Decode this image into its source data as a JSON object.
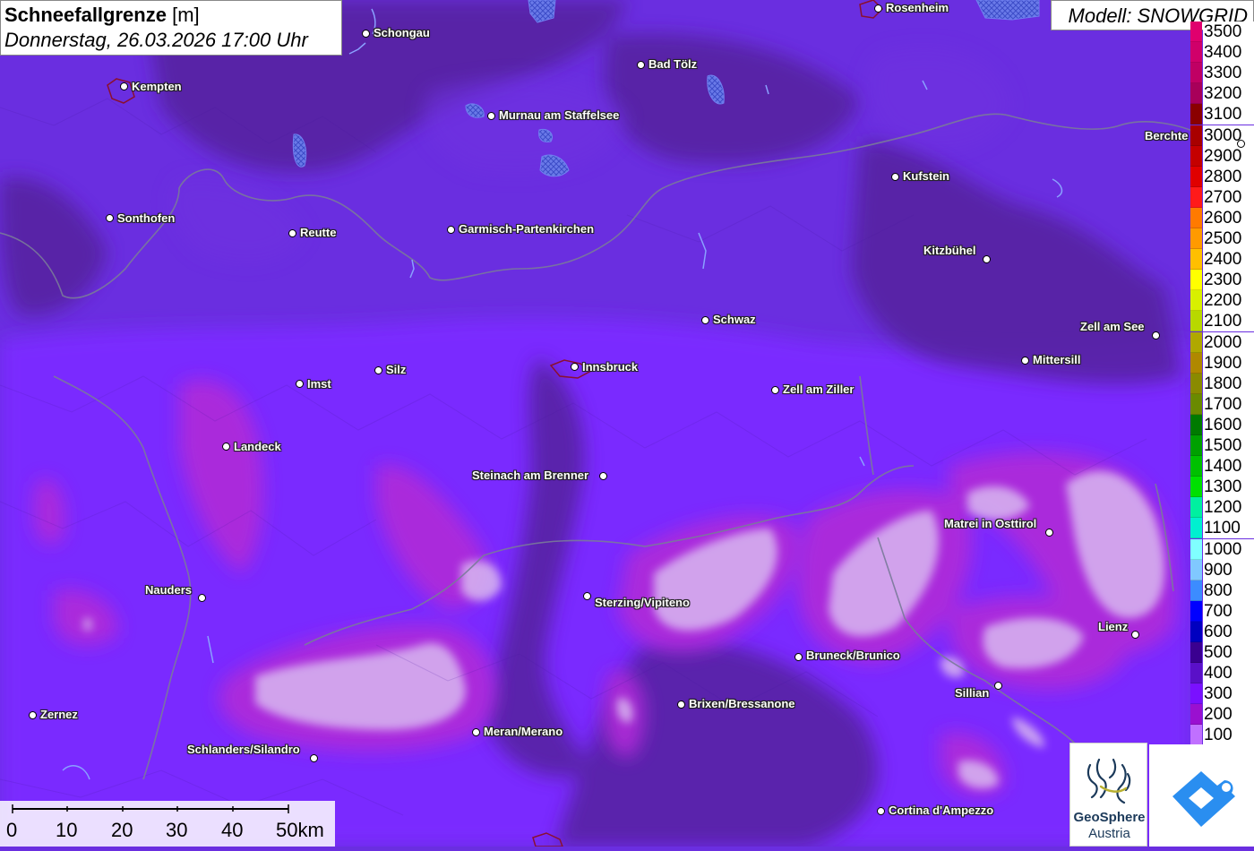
{
  "title": {
    "variable": "Schneefallgrenze",
    "unit": "[m]",
    "datetime": "Donnerstag, 26.03.2026 17:00 Uhr"
  },
  "model_label": "Modell: SNOWGRID",
  "legend": {
    "entries": [
      {
        "label": "3500",
        "color": "#e0006e"
      },
      {
        "label": "3400",
        "color": "#d0006a"
      },
      {
        "label": "3300",
        "color": "#c00064"
      },
      {
        "label": "3200",
        "color": "#a8005a"
      },
      {
        "label": "3100",
        "color": "#8a0000"
      },
      {
        "label": "3000",
        "color": "#a80000"
      },
      {
        "label": "2900",
        "color": "#c40000"
      },
      {
        "label": "2800",
        "color": "#e00000"
      },
      {
        "label": "2700",
        "color": "#ff1a1a"
      },
      {
        "label": "2600",
        "color": "#ff7a00"
      },
      {
        "label": "2500",
        "color": "#ff9a00"
      },
      {
        "label": "2400",
        "color": "#ffbf00"
      },
      {
        "label": "2300",
        "color": "#ffff00"
      },
      {
        "label": "2200",
        "color": "#d8f000"
      },
      {
        "label": "2100",
        "color": "#b8d800"
      },
      {
        "label": "2000",
        "color": "#b0a800"
      },
      {
        "label": "1900",
        "color": "#b08800"
      },
      {
        "label": "1800",
        "color": "#8a8a00"
      },
      {
        "label": "1700",
        "color": "#6a8a00"
      },
      {
        "label": "1600",
        "color": "#007a00"
      },
      {
        "label": "1500",
        "color": "#00a000"
      },
      {
        "label": "1400",
        "color": "#00c000"
      },
      {
        "label": "1300",
        "color": "#00e000"
      },
      {
        "label": "1200",
        "color": "#00f0a0"
      },
      {
        "label": "1100",
        "color": "#00f0d0"
      },
      {
        "label": "1000",
        "color": "#80ffff"
      },
      {
        "label": "900",
        "color": "#80c8ff"
      },
      {
        "label": "800",
        "color": "#3c8cff"
      },
      {
        "label": "700",
        "color": "#0000ff"
      },
      {
        "label": "600",
        "color": "#0000c0"
      },
      {
        "label": "500",
        "color": "#3a0090"
      },
      {
        "label": "400",
        "color": "#5a10c8"
      },
      {
        "label": "300",
        "color": "#7a10ff"
      },
      {
        "label": "200",
        "color": "#9a10d0"
      },
      {
        "label": "100",
        "color": "#c070ff"
      }
    ]
  },
  "cities": [
    {
      "name": "Rosenheim"
    },
    {
      "name": "Schongau"
    },
    {
      "name": "Kempten"
    },
    {
      "name": "Bad Tölz"
    },
    {
      "name": "Murnau am Staffelsee"
    },
    {
      "name": "Berchte"
    },
    {
      "name": "Kufstein"
    },
    {
      "name": "Sonthofen"
    },
    {
      "name": "Reutte"
    },
    {
      "name": "Garmisch-Partenkirchen"
    },
    {
      "name": "Kitzbühel"
    },
    {
      "name": "Schwaz"
    },
    {
      "name": "Zell am See"
    },
    {
      "name": "Mittersill"
    },
    {
      "name": "Silz"
    },
    {
      "name": "Innsbruck"
    },
    {
      "name": "Imst"
    },
    {
      "name": "Zell am Ziller"
    },
    {
      "name": "Landeck"
    },
    {
      "name": "Steinach am Brenner"
    },
    {
      "name": "Matrei in Osttirol"
    },
    {
      "name": "Nauders"
    },
    {
      "name": "Sterzing/Vipiteno"
    },
    {
      "name": "Lienz"
    },
    {
      "name": "Bruneck/Brunico"
    },
    {
      "name": "Sillian"
    },
    {
      "name": "Brixen/Bressanone"
    },
    {
      "name": "Zernez"
    },
    {
      "name": "Meran/Merano"
    },
    {
      "name": "Schlanders/Silandro"
    },
    {
      "name": "Cortina d'Ampezzo"
    }
  ],
  "scale_bar": {
    "ticks": [
      "0",
      "10",
      "20",
      "30",
      "40",
      "50km"
    ]
  },
  "logos": {
    "geosphere_name": "GeoSphere",
    "geosphere_sub": "Austria"
  }
}
